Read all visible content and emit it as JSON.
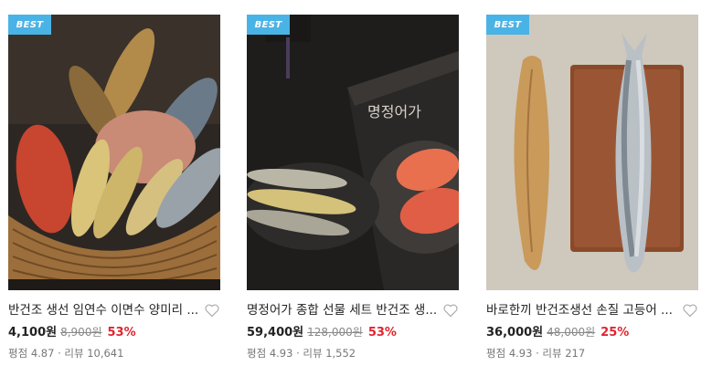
{
  "products": [
    {
      "badge": "BEST",
      "title": "반건조 생선 임연수 이면수 양미리 ...",
      "price": "4,100원",
      "original_price": "8,900원",
      "discount": "53%",
      "rating_label": "평점 4.87",
      "review_label": "리뷰 10,641",
      "image_icon": "dried-fish-basket-image"
    },
    {
      "badge": "BEST",
      "title": "명정어가 종합 선물 세트 반건조 생...",
      "price": "59,400원",
      "original_price": "128,000원",
      "discount": "53%",
      "rating_label": "평점 4.93",
      "review_label": "리뷰 1,552",
      "image_icon": "gift-set-fish-image",
      "package_text": "명정어가"
    },
    {
      "badge": "BEST",
      "title": "바로한끼 반건조생선 손질 고등어 ...",
      "price": "36,000원",
      "original_price": "48,000원",
      "discount": "25%",
      "rating_label": "평점 4.93",
      "review_label": "리뷰 217",
      "image_icon": "mackerel-board-image"
    }
  ],
  "separator": "·",
  "colors": {
    "badge": "#4ab3e5",
    "discount": "#e0242f"
  }
}
